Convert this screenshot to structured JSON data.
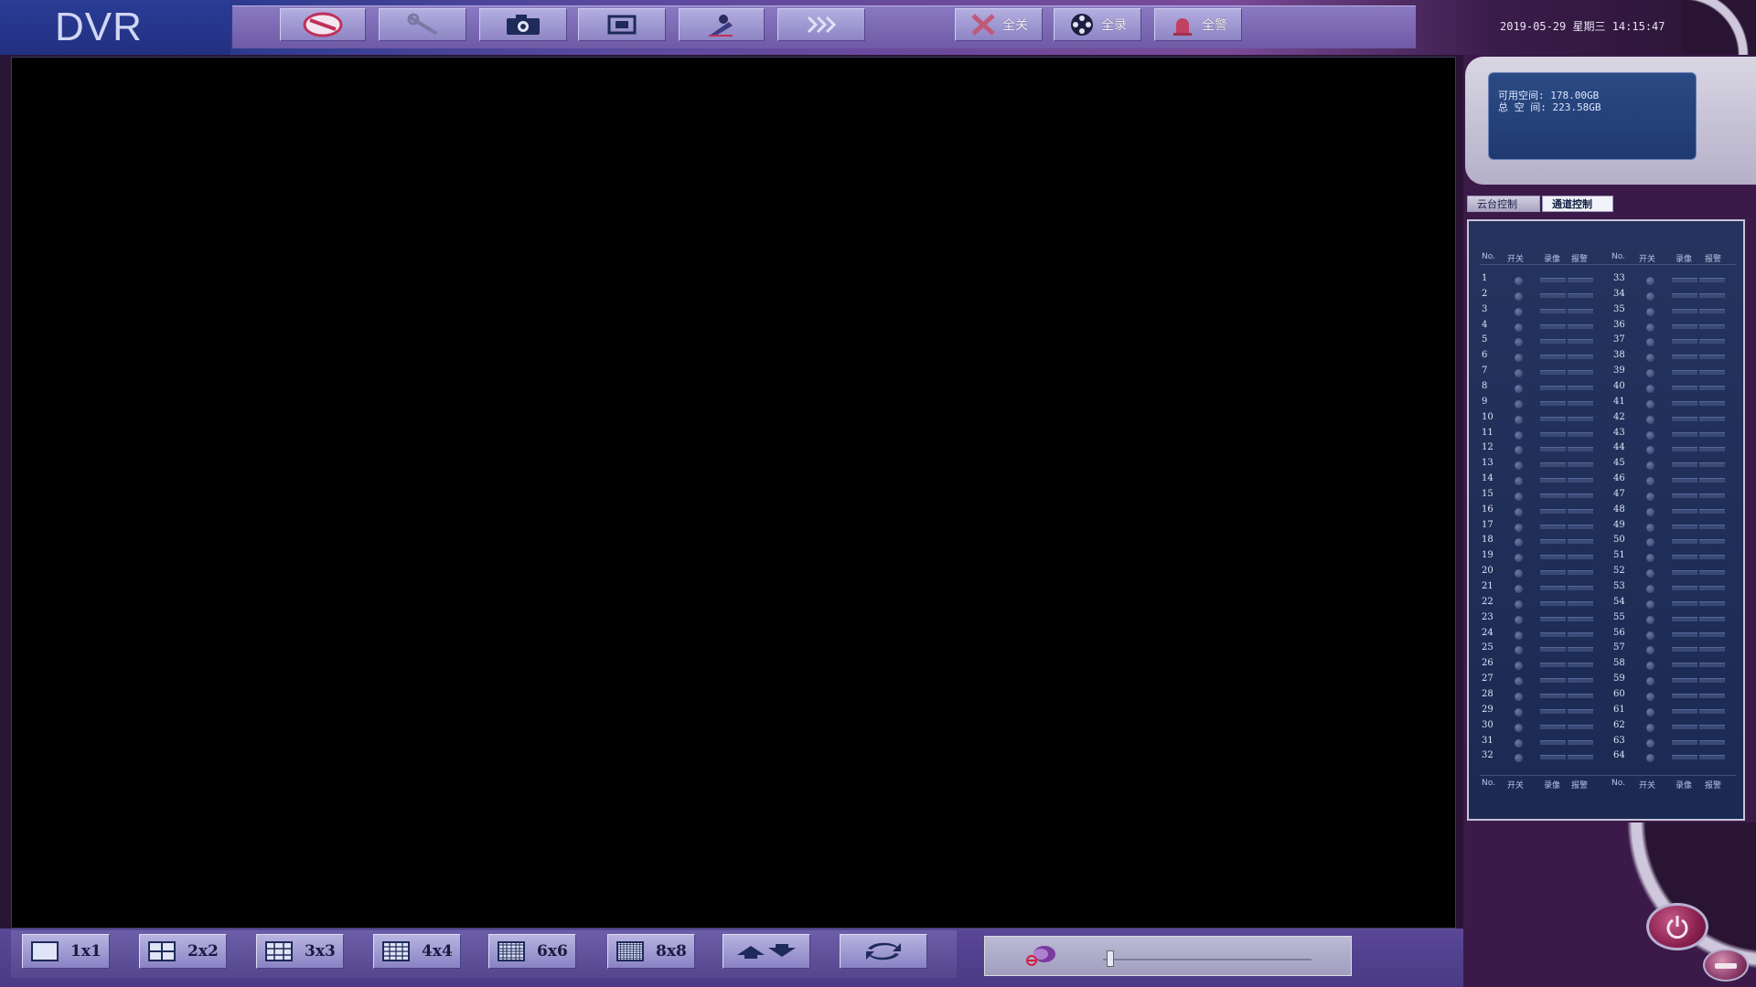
{
  "app": {
    "logo": "DVR"
  },
  "toolbar": {
    "close_all_label": "全关",
    "record_all_label": "全录",
    "alarm_all_label": "全警"
  },
  "status": {
    "datetime": "2019-05-29 星期三 14:15:47"
  },
  "disk": {
    "free_label": "可用空间: 178.00GB",
    "total_label": "总 空 间: 223.58GB"
  },
  "tabs": {
    "ptz": "云台控制",
    "channel": "通道控制"
  },
  "channel_table": {
    "headers": [
      "No.",
      "开关",
      "录像",
      "报警",
      "No.",
      "开关",
      "录像",
      "报警"
    ],
    "left_channels": [
      "1",
      "2",
      "3",
      "4",
      "5",
      "6",
      "7",
      "8",
      "9",
      "10",
      "11",
      "12",
      "13",
      "14",
      "15",
      "16",
      "17",
      "18",
      "19",
      "20",
      "21",
      "22",
      "23",
      "24",
      "25",
      "26",
      "27",
      "28",
      "29",
      "30",
      "31",
      "32"
    ],
    "right_channels": [
      "33",
      "34",
      "35",
      "36",
      "37",
      "38",
      "39",
      "40",
      "41",
      "42",
      "43",
      "44",
      "45",
      "46",
      "47",
      "48",
      "49",
      "50",
      "51",
      "52",
      "53",
      "54",
      "55",
      "56",
      "57",
      "58",
      "59",
      "60",
      "61",
      "62",
      "63",
      "64"
    ]
  },
  "layouts": {
    "l1": "1x1",
    "l2": "2x2",
    "l3": "3x3",
    "l4": "4x4",
    "l6": "6x6",
    "l8": "8x8"
  },
  "volume": {
    "level": 0.02
  },
  "colors": {
    "accent": "#7a4a98",
    "panel": "#24345e",
    "button": "#b4aee0"
  }
}
